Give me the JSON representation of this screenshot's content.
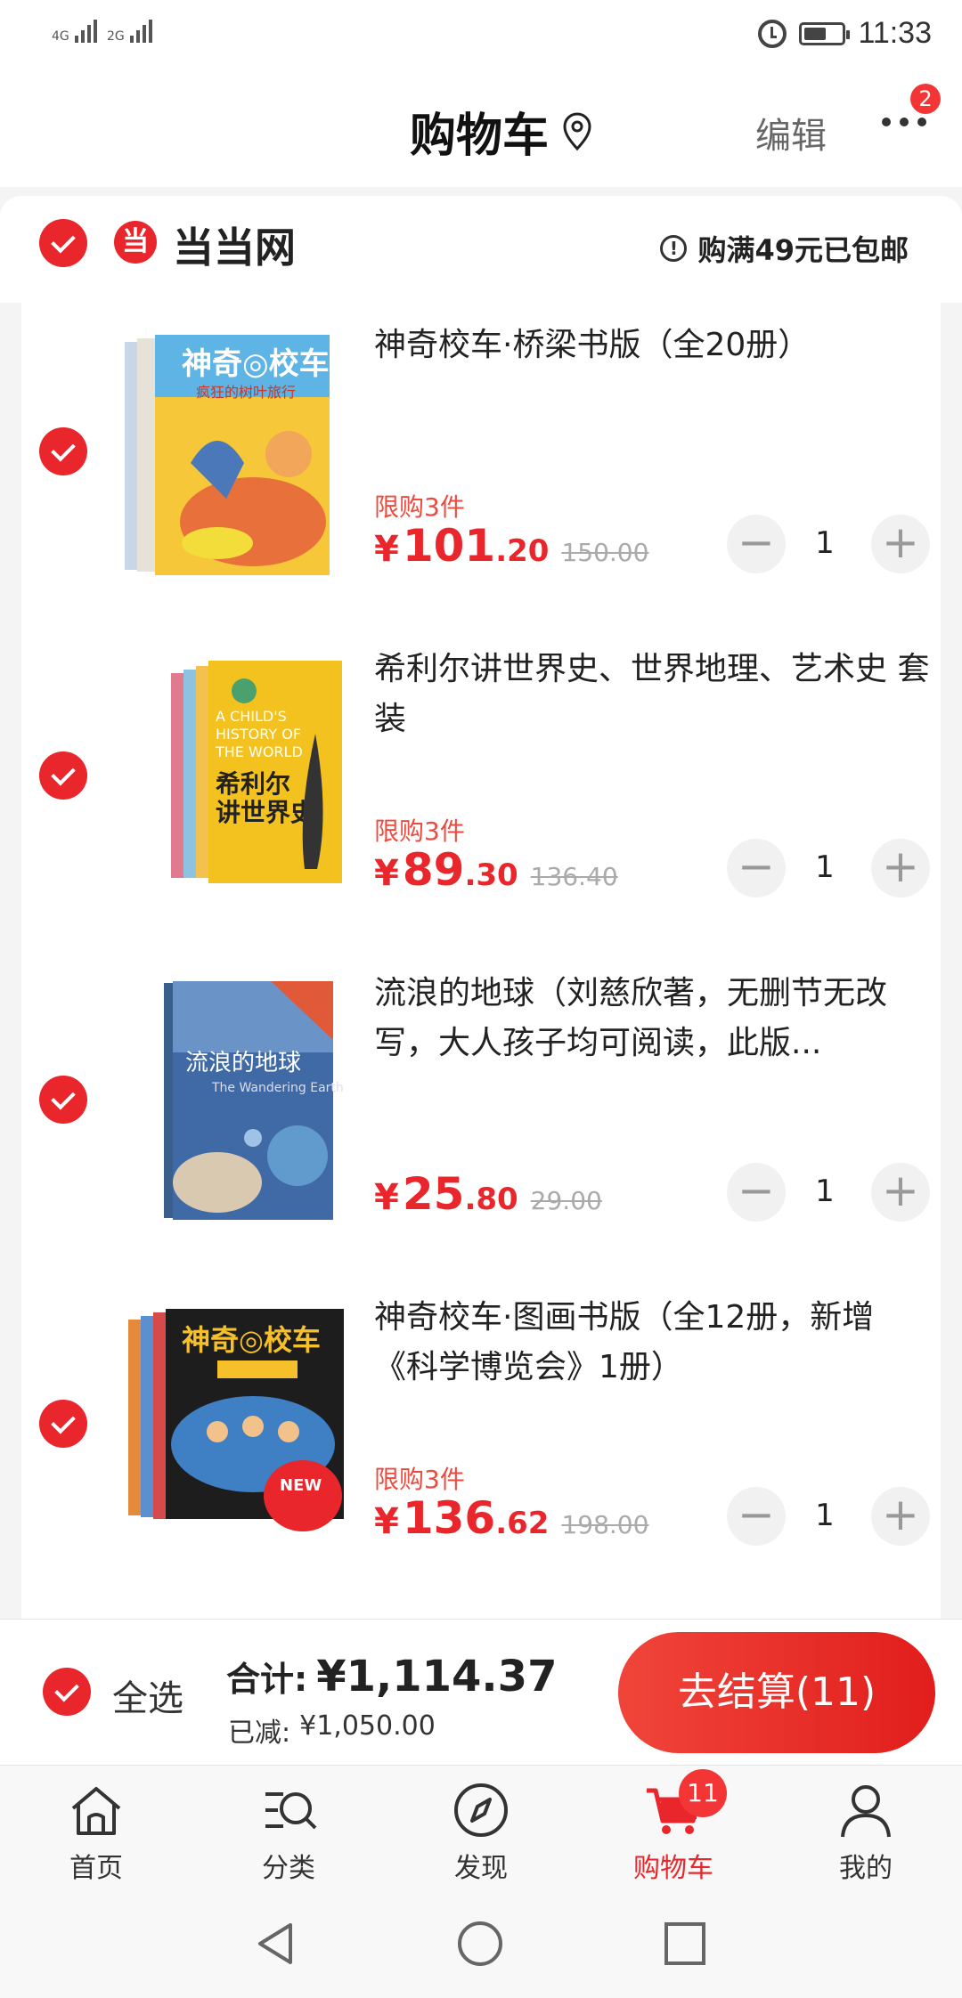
{
  "status": {
    "net1": "4G",
    "net2": "2G",
    "time": "11:33"
  },
  "header": {
    "title": "购物车",
    "edit": "编辑",
    "more_badge": "2"
  },
  "store": {
    "logo_char": "当",
    "name": "当当网",
    "shipping": "购满49元已包邮"
  },
  "items": [
    {
      "title": "神奇校车·桥梁书版（全20册）",
      "limit": "限购3件",
      "yen": "¥",
      "price_int": "101",
      "price_dec": ".20",
      "original": "150.00",
      "qty": "1"
    },
    {
      "title": "希利尔讲世界史、世界地理、艺术史 套装",
      "limit": "限购3件",
      "yen": "¥",
      "price_int": "89",
      "price_dec": ".30",
      "original": "136.40",
      "qty": "1"
    },
    {
      "title": "流浪的地球（刘慈欣著，无删节无改写，大人孩子均可阅读，此版...",
      "limit": "",
      "yen": "¥",
      "price_int": "25",
      "price_dec": ".80",
      "original": "29.00",
      "qty": "1"
    },
    {
      "title": "神奇校车·图画书版（全12册，新增《科学博览会》1册）",
      "limit": "限购3件",
      "yen": "¥",
      "price_int": "136",
      "price_dec": ".62",
      "original": "198.00",
      "qty": "1"
    }
  ],
  "stepper": {
    "minus": "−",
    "plus": "+"
  },
  "checkout": {
    "select_all": "全选",
    "total_label": "合计:",
    "total_value": "¥1,114.37",
    "saved_label": "已减:",
    "saved_value": "¥1,050.00",
    "button": "去结算(11)"
  },
  "tabs": [
    {
      "label": "首页",
      "icon": "home-icon"
    },
    {
      "label": "分类",
      "icon": "category-search-icon"
    },
    {
      "label": "发现",
      "icon": "compass-icon"
    },
    {
      "label": "购物车",
      "icon": "cart-icon",
      "badge": "11",
      "active": true
    },
    {
      "label": "我的",
      "icon": "user-icon"
    }
  ],
  "colors": {
    "accent": "#e8262b",
    "limit": "#ee4b3e",
    "strike": "#aaaaaa"
  }
}
